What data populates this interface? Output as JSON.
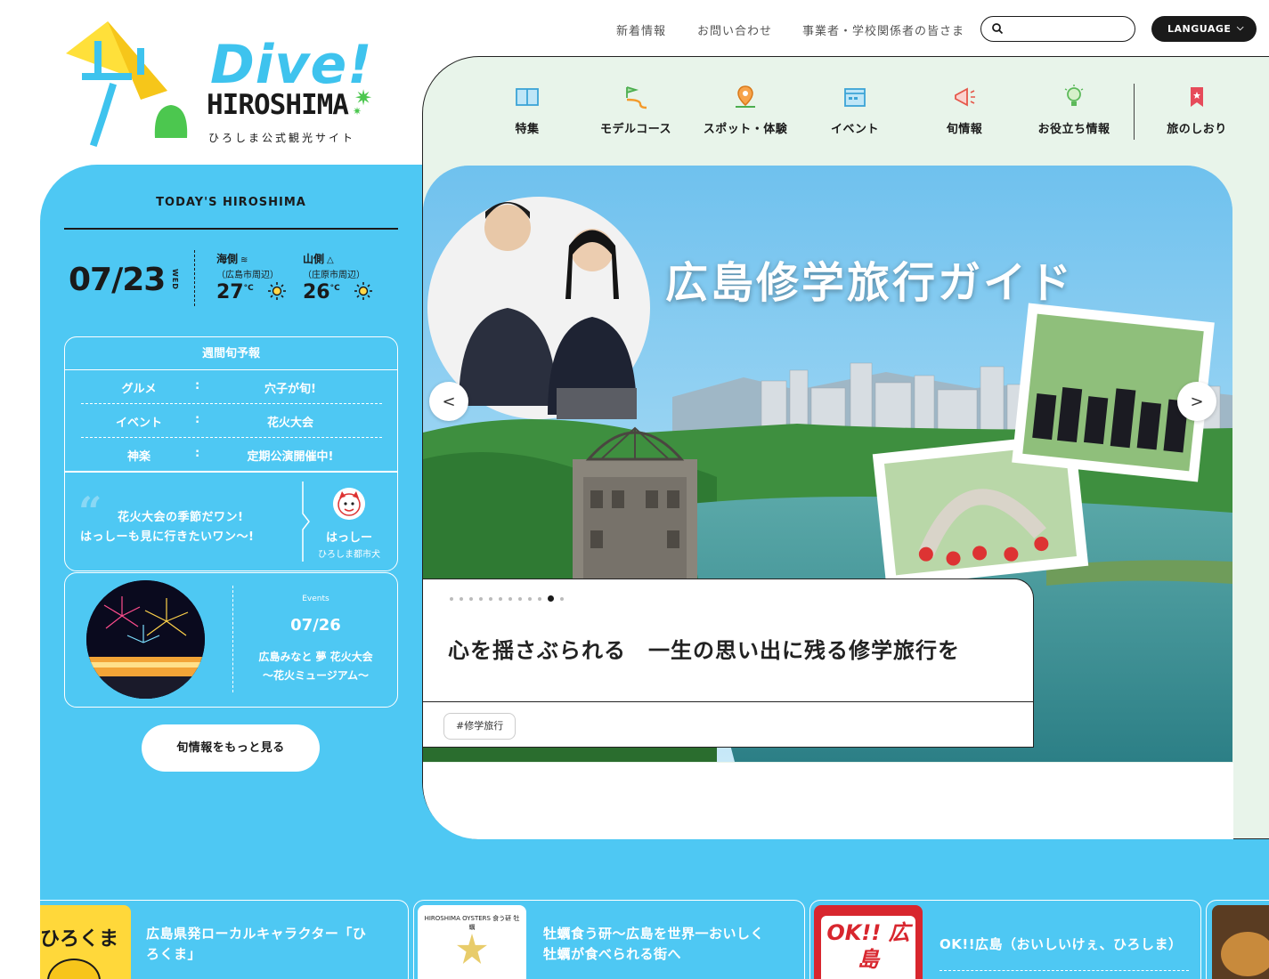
{
  "logo": {
    "dive": "Dive!",
    "hiroshima": "HIROSHIMA",
    "subtitle": "ひろしま公式観光サイト"
  },
  "top_links": [
    "新着情報",
    "お問い合わせ",
    "事業者・学校関係者の皆さま"
  ],
  "search": {
    "placeholder": "",
    "value": ""
  },
  "language": {
    "label": "LANGUAGE"
  },
  "main_nav": [
    {
      "label": "特集",
      "icon": "book-icon"
    },
    {
      "label": "モデルコース",
      "icon": "route-flag-icon"
    },
    {
      "label": "スポット・体験",
      "icon": "map-pin-icon"
    },
    {
      "label": "イベント",
      "icon": "calendar-icon"
    },
    {
      "label": "旬情報",
      "icon": "megaphone-icon"
    },
    {
      "label": "お役立ち情報",
      "icon": "lightbulb-icon"
    },
    {
      "label": "旅のしおり",
      "icon": "bookmark-icon"
    }
  ],
  "hero": {
    "title": "広島修学旅行ガイド",
    "prev": "<",
    "next": ">",
    "caption": "心を揺さぶられる　一生の思い出に残る修学旅行を",
    "tag": "#修学旅行",
    "slide_count": 12,
    "active_slide": 11
  },
  "today": {
    "title": "TODAY'S HIROSHIMA",
    "date": "07/23",
    "weekday": "WED",
    "sea": {
      "name": "海側",
      "symbol": "≋",
      "area": "（広島市周辺）",
      "temp": "27",
      "unit": "°C"
    },
    "mountain": {
      "name": "山側",
      "symbol": "△",
      "area": "（庄原市周辺）",
      "temp": "26",
      "unit": "°C"
    }
  },
  "forecast": {
    "title": "週間旬予報",
    "rows": [
      {
        "key": "グルメ",
        "colon": ":",
        "value": "穴子が旬!"
      },
      {
        "key": "イベント",
        "colon": ":",
        "value": "花火大会"
      },
      {
        "key": "神楽",
        "colon": ":",
        "value": "定期公演開催中!"
      }
    ],
    "quote_mark": "“",
    "quote_line1": "花火大会の季節だワン!",
    "quote_line2": "はっしーも見に行きたいワン〜!",
    "mascot_name": "はっしー",
    "mascot_role": "ひろしま都市犬"
  },
  "event": {
    "label": "Events",
    "date": "07/26",
    "name_line1": "広島みなと 夢 花火大会",
    "name_line2": "〜花火ミュージアム〜"
  },
  "more_button": "旬情報をもっと見る",
  "cards": [
    {
      "thumb_text": "ひろくま",
      "text": "広島県発ローカルキャラクター「ひろくま」"
    },
    {
      "thumb_text": "HIROSHIMA OYSTERS 食う研 牡蠣",
      "text": "牡蠣食う研〜広島を世界一おいしく牡蠣が食べられる街へ"
    },
    {
      "thumb_text": "OK!! 広島",
      "text": "OK!!広島（おいしいけぇ、ひろしま）"
    }
  ],
  "colors": {
    "blue": "#4ec8f3",
    "mint": "#e8f4ea",
    "dark": "#1a1a1a"
  }
}
